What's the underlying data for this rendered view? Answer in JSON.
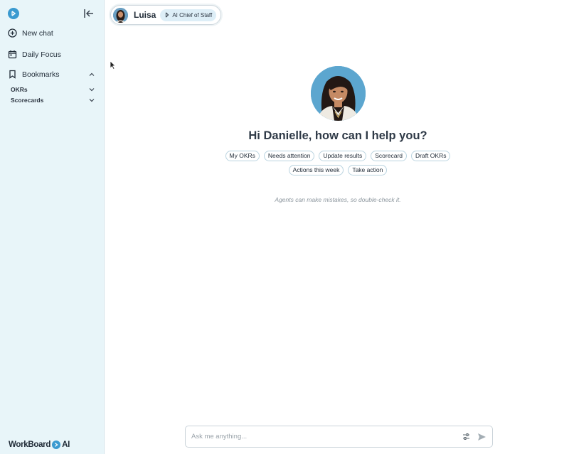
{
  "sidebar": {
    "new_chat": "New chat",
    "daily_focus": "Daily Focus",
    "bookmarks": "Bookmarks",
    "sub_items": [
      {
        "label": "OKRs"
      },
      {
        "label": "Scorecards"
      }
    ],
    "brand": {
      "prefix": "WorkBoard",
      "suffix": "AI"
    }
  },
  "agent": {
    "name": "Luisa",
    "role": "AI Chief of Staff"
  },
  "main": {
    "greeting": "Hi Danielle, how can I help you?",
    "chips_row1": [
      "My OKRs",
      "Needs attention",
      "Update results",
      "Scorecard",
      "Draft OKRs"
    ],
    "chips_row2": [
      "Actions this week",
      "Take action"
    ],
    "disclaimer": "Agents can make mistakes, so double-check it."
  },
  "composer": {
    "placeholder": "Ask me anything...",
    "value": ""
  },
  "colors": {
    "sidebar_bg": "#e8f5f9",
    "accent": "#3a9ad0",
    "chip_border": "#b9d3df"
  }
}
